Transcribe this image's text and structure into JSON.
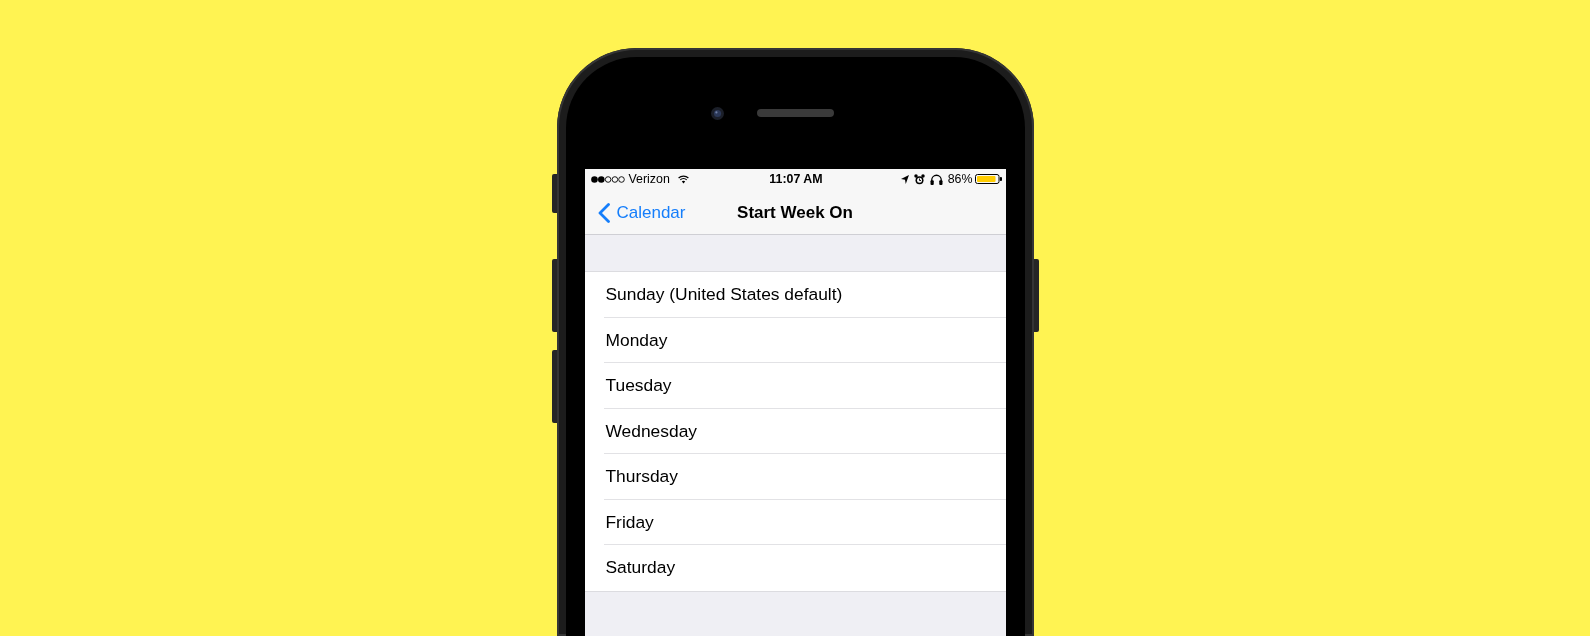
{
  "status_bar": {
    "carrier": "Verizon",
    "time": "11:07 AM",
    "battery": "86%"
  },
  "nav_bar": {
    "back": "Calendar",
    "title": "Start Week On"
  },
  "options": [
    {
      "label": "Sunday (United States default)",
      "selected": false
    },
    {
      "label": "Monday",
      "selected": false
    },
    {
      "label": "Tuesday",
      "selected": false
    },
    {
      "label": "Wednesday",
      "selected": false
    },
    {
      "label": "Thursday",
      "selected": false
    },
    {
      "label": "Friday",
      "selected": false
    },
    {
      "label": "Saturday",
      "selected": false
    }
  ]
}
